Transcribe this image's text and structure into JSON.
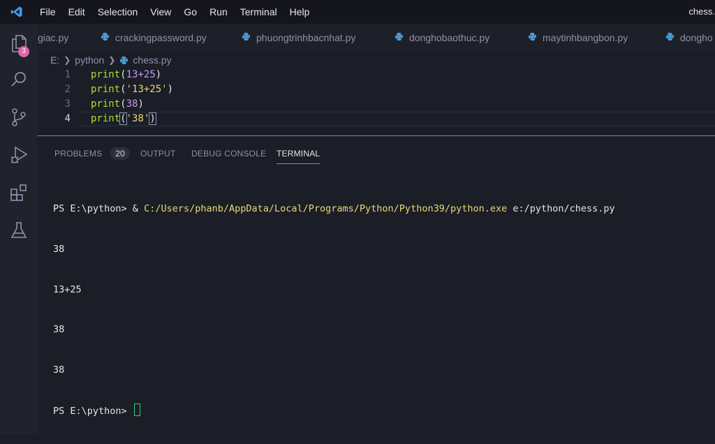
{
  "menubar": {
    "items": [
      "File",
      "Edit",
      "Selection",
      "View",
      "Go",
      "Run",
      "Terminal",
      "Help"
    ],
    "title_right": "chess."
  },
  "activitybar": {
    "explorer_badge": "3",
    "icons": [
      "explorer-icon",
      "search-icon",
      "source-control-icon",
      "run-debug-icon",
      "extensions-icon",
      "testing-icon"
    ]
  },
  "tabs": [
    {
      "label": "giac.py"
    },
    {
      "label": "crackingpassword.py"
    },
    {
      "label": "phuongtrinhbacnhat.py"
    },
    {
      "label": "donghobaothuc.py"
    },
    {
      "label": "maytinhbangbon.py"
    },
    {
      "label": "dongho"
    }
  ],
  "breadcrumb": {
    "drive": "E:",
    "folder": "python",
    "file": "chess.py"
  },
  "editor": {
    "lines": [
      {
        "n": "1",
        "fn": "print",
        "open": "(",
        "a": "13",
        "op": "+",
        "b": "25",
        "close": ")"
      },
      {
        "n": "2",
        "fn": "print",
        "open": "(",
        "str": "'13+25'",
        "close": ")"
      },
      {
        "n": "3",
        "fn": "print",
        "open": "(",
        "a": "38",
        "close": ")"
      },
      {
        "n": "4",
        "fn": "print",
        "open": "(",
        "str": "'38'",
        "close": ")"
      }
    ]
  },
  "panel": {
    "tabs": {
      "problems": "PROBLEMS",
      "problems_count": "20",
      "output": "OUTPUT",
      "debug": "DEBUG CONSOLE",
      "terminal": "TERMINAL"
    }
  },
  "terminal": {
    "prompt": "PS E:\\python> ",
    "command_prefix": "& ",
    "command_path": "C:/Users/phanb/AppData/Local/Programs/Python/Python39/python.exe",
    "command_arg": " e:/python/chess.py",
    "output": [
      "38",
      "13+25",
      "38",
      "38"
    ],
    "final_prompt": "PS E:\\python> "
  },
  "colors": {
    "accent": "#e064a8",
    "panel_border": "#a46bd6",
    "function": "#a6e22e",
    "number": "#c79bf0",
    "string": "#e6db74"
  }
}
